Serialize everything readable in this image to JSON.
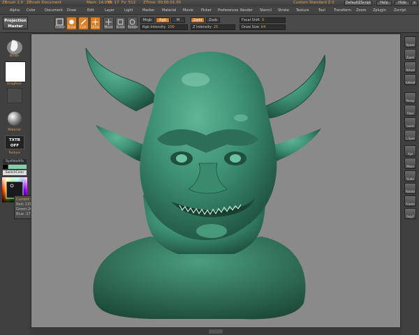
{
  "titlebar": {
    "app": "ZBrush 2.0",
    "document": "ZBrush Document",
    "mem": "Mem: 14.055",
    "vertex": "Vt: 17",
    "face": "Fz: 512",
    "time": "ZTime: 00:00:01.05",
    "brand": "Custom Standard Z.0",
    "default_script": "DefaultZScript",
    "help": "Help",
    "hide": "Hide"
  },
  "menubar": {
    "items": [
      "Alpha",
      "Color",
      "Document",
      "Draw",
      "Edit",
      "Layer",
      "Light",
      "Marker",
      "Material",
      "Movie",
      "Picker",
      "Preferences",
      "Render",
      "Stencil",
      "Stroke",
      "Texture",
      "Tool",
      "Transform",
      "Zoom",
      "Zplugin",
      "Zscript"
    ]
  },
  "toolbar": {
    "projection_master": [
      "Projection",
      "Master"
    ],
    "tools": [
      {
        "label": "Frame",
        "color": "gray"
      },
      {
        "label": "Draw",
        "color": "orange"
      },
      {
        "label": "Edit",
        "color": "orange"
      },
      {
        "label": "Draw",
        "color": "orange"
      },
      {
        "label": "Move",
        "color": "gray"
      },
      {
        "label": "Scale",
        "color": "gray"
      },
      {
        "label": "Rotate",
        "color": "gray"
      }
    ],
    "mrgb": "Mrgb",
    "rgb": "Rgb",
    "m": "M",
    "zadd": "Zadd",
    "zsub": "Zsub",
    "rgb_intensity_label": "Rgb Intensity",
    "rgb_intensity_value": "100",
    "z_intensity_label": "Z Intensity",
    "z_intensity_value": "25",
    "focal_shift_label": "Focal Shift",
    "focal_shift_value": "0",
    "draw_size_label": "Draw Size",
    "draw_size_value": "64"
  },
  "leftshelf": {
    "brush_label": "Brush",
    "stroke_label": "DragRect",
    "material_label": "Material",
    "texture_label": "Texture",
    "texture_off": [
      "TXTR",
      "OFF"
    ],
    "gradient_label": "SysPaleAlfa",
    "switch_color": "SwitchColor"
  },
  "tooltip": {
    "title": "Current Color",
    "red": "Red: 131",
    "green": "Green:209",
    "blue": "Blue :172"
  },
  "rightshelf": {
    "buttons": [
      "Xpose",
      "Zoom",
      "Actual",
      "AAHalf",
      "Persp",
      "Floor",
      "Local",
      "L.Sym",
      "Xyz",
      "Move",
      "Scale",
      "Rotate",
      "Frame",
      "PolyF"
    ]
  },
  "colors": {
    "accent": "#e8a64a",
    "model": "#3c8f73",
    "canvas": "#8a8a8a",
    "current_color": "#83d1ac"
  }
}
